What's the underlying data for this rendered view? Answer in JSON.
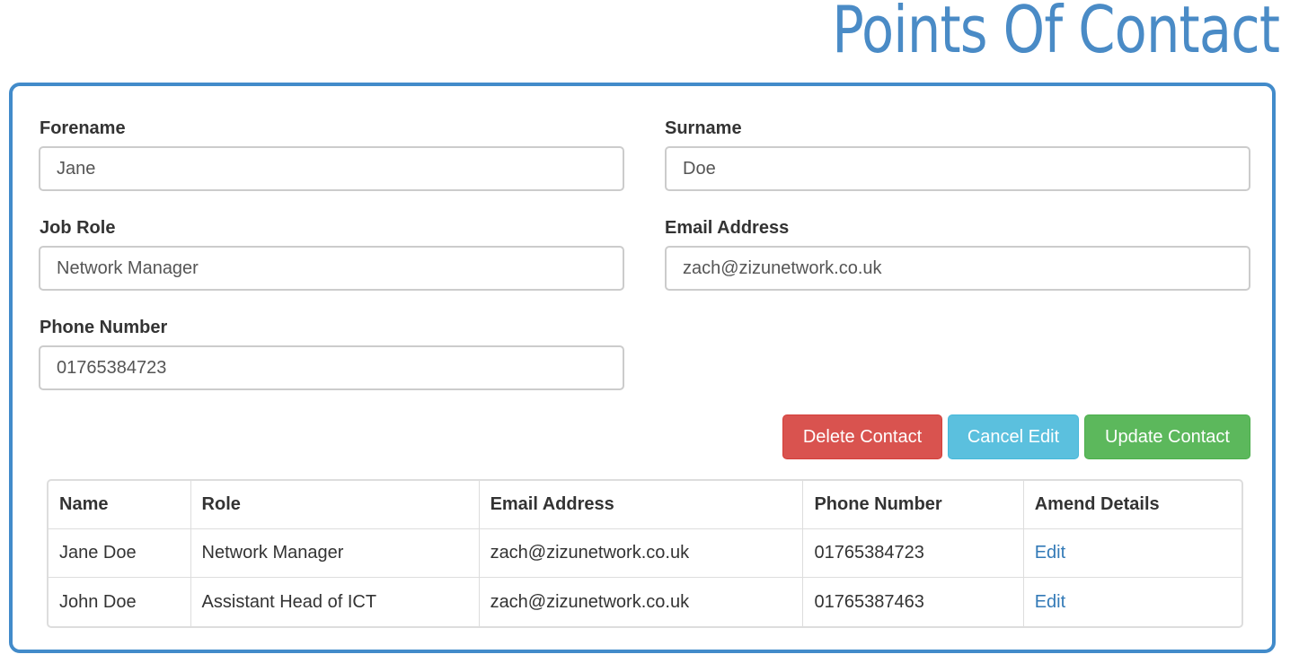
{
  "page_title": "Points Of Contact",
  "form": {
    "forename": {
      "label": "Forename",
      "value": "Jane"
    },
    "surname": {
      "label": "Surname",
      "value": "Doe"
    },
    "job_role": {
      "label": "Job Role",
      "value": "Network Manager"
    },
    "email": {
      "label": "Email Address",
      "value": "zach@zizunetwork.co.uk"
    },
    "phone": {
      "label": "Phone Number",
      "value": "01765384723"
    }
  },
  "buttons": {
    "delete": "Delete Contact",
    "cancel": "Cancel Edit",
    "update": "Update Contact"
  },
  "colors": {
    "accent": "#428bca",
    "danger": "#d9534f",
    "info": "#5bc0de",
    "success": "#5cb85c",
    "link": "#337ab7"
  },
  "table": {
    "headers": [
      "Name",
      "Role",
      "Email Address",
      "Phone Number",
      "Amend Details"
    ],
    "rows": [
      {
        "name": "Jane Doe",
        "role": "Network Manager",
        "email": "zach@zizunetwork.co.uk",
        "phone": "01765384723",
        "action": "Edit"
      },
      {
        "name": "John Doe",
        "role": "Assistant Head of ICT",
        "email": "zach@zizunetwork.co.uk",
        "phone": "01765387463",
        "action": "Edit"
      }
    ]
  }
}
